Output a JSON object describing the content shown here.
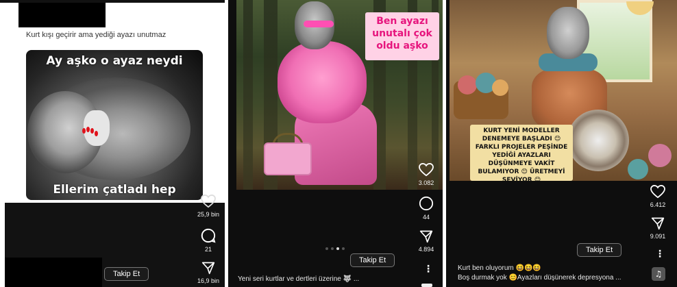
{
  "panel1": {
    "caption": "Kurt kışı geçirir ama yediği ayazı unutmaz",
    "meme_top": "Ay aşko o ayaz neydi",
    "meme_bottom": "Ellerim çatladı hep",
    "likes": "25,9 bin",
    "comments": "21",
    "shares": "16,9 bin",
    "follow_label": "Takip Et"
  },
  "panel2": {
    "speech_text": "Ben ayazı unutalı çok oldu aşko",
    "likes": "3.082",
    "comments": "44",
    "shares": "4.894",
    "follow_label": "Takip Et",
    "caption": "Yeni seri kurtlar ve dertleri üzerine 🐺 ...",
    "carousel": {
      "total": 4,
      "active": 3
    }
  },
  "panel3": {
    "textbox_text": "KURT YENİ MODELLER DENEMEYE BAŞLADI 😊 FARKLI PROJELER PEŞİNDE YEDİĞİ AYAZLARI DÜŞÜNMEYE VAKİT BULAMIYOR 😊 ÜRETMEYİ SEVİYOR 😊",
    "likes": "6.412",
    "shares": "9.091",
    "follow_label": "Takip Et",
    "caption_line1": "Kurt ben oluyorum 😆😆😆",
    "caption_line2": "Boş durmak yok 😊Ayazları düşünerek depresyona ...",
    "music_icon": "♫"
  },
  "icons": {
    "like": "heart-icon",
    "comment": "comment-bubble-icon",
    "share": "send-icon",
    "more": "more-vertical-icon"
  },
  "colors": {
    "dark_bg": "#0e0e0e",
    "speech_bg": "#ffd2e6",
    "speech_text": "#e6157d",
    "textbox_bg": "#f2dfa3"
  }
}
